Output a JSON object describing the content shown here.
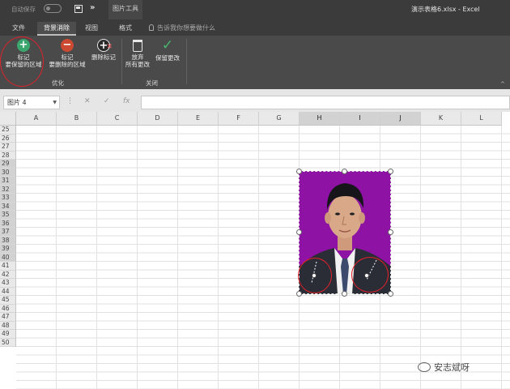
{
  "titlebar": {
    "autosave": "自动保存",
    "more": "»",
    "tools_label": "图片工具",
    "doc_title": "演示表格6.xlsx  -  Excel"
  },
  "tabs": [
    {
      "label": "文件",
      "active": false
    },
    {
      "label": "背景消除",
      "active": true
    },
    {
      "label": "视图",
      "active": false
    },
    {
      "label": "格式",
      "active": false
    }
  ],
  "tell_me": "告诉我你想要做什么",
  "ribbon": {
    "refine_group": "优化",
    "close_group": "关闭",
    "mark_keep": {
      "line1": "标记",
      "line2": "要保留的区域"
    },
    "mark_remove": {
      "line1": "标记",
      "line2": "要删除的区域"
    },
    "delete_mark": {
      "line1": "删除标记"
    },
    "discard": {
      "line1": "放弃",
      "line2": "所有更改"
    },
    "keep_changes": {
      "line1": "保留更改"
    },
    "collapse": "^"
  },
  "formula_bar": {
    "name_box": "图片 4",
    "dropdown": "▼",
    "dots": "⋮",
    "cancel": "✕",
    "enter": "✓",
    "fx": "fx",
    "value": ""
  },
  "columns": [
    "A",
    "B",
    "C",
    "D",
    "E",
    "F",
    "G",
    "H",
    "I",
    "J",
    "K",
    "L"
  ],
  "selected_columns": [
    "H",
    "I",
    "J"
  ],
  "rows": [
    "25",
    "26",
    "27",
    "28",
    "29",
    "30",
    "31",
    "32",
    "33",
    "34",
    "35",
    "36",
    "37",
    "38",
    "39",
    "40",
    "41",
    "42",
    "43",
    "44",
    "45",
    "46",
    "47",
    "48",
    "49",
    "50"
  ],
  "selected_rows": [
    "29",
    "30",
    "31",
    "32",
    "33",
    "34",
    "35",
    "36",
    "37",
    "38",
    "39",
    "40"
  ],
  "photo": {
    "background_color": "#8e12a4"
  },
  "watermark": "安志斌呀",
  "colors": {
    "accent_red": "#e0222a",
    "keep_green": "#3aa56c",
    "remove_red": "#cc4a32"
  }
}
